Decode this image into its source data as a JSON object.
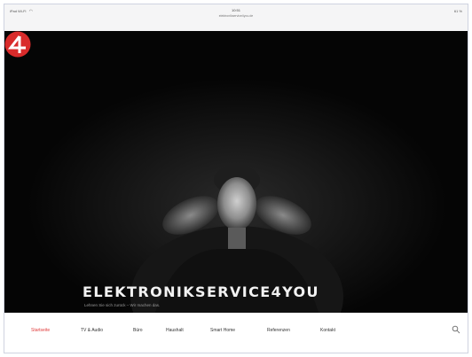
{
  "status_bar": {
    "carrier": "iPad Wi-Fi",
    "time": "10:51",
    "url": "elektronikservice4you.de",
    "battery": "61 %"
  },
  "hero": {
    "title": "ELEKTRONIKSERVICE4YOU",
    "tagline": "Lehnen Sie sich zurück – Wir machen das."
  },
  "nav": {
    "items": [
      {
        "label": "Startseite",
        "active": true
      },
      {
        "label": "TV & Audio",
        "active": false
      },
      {
        "label": "Büro",
        "active": false
      },
      {
        "label": "Haushalt",
        "active": false
      },
      {
        "label": "Smart Home",
        "active": false
      },
      {
        "label": "Referenzen",
        "active": false
      },
      {
        "label": "Kontakt",
        "active": false
      }
    ]
  },
  "icons": {
    "logo": "brand-logo-4",
    "search": "search-icon",
    "wifi": "wifi-icon"
  },
  "colors": {
    "accent": "#e03b3b",
    "hero_bg": "#050505",
    "logo_red": "#d92b2b"
  }
}
